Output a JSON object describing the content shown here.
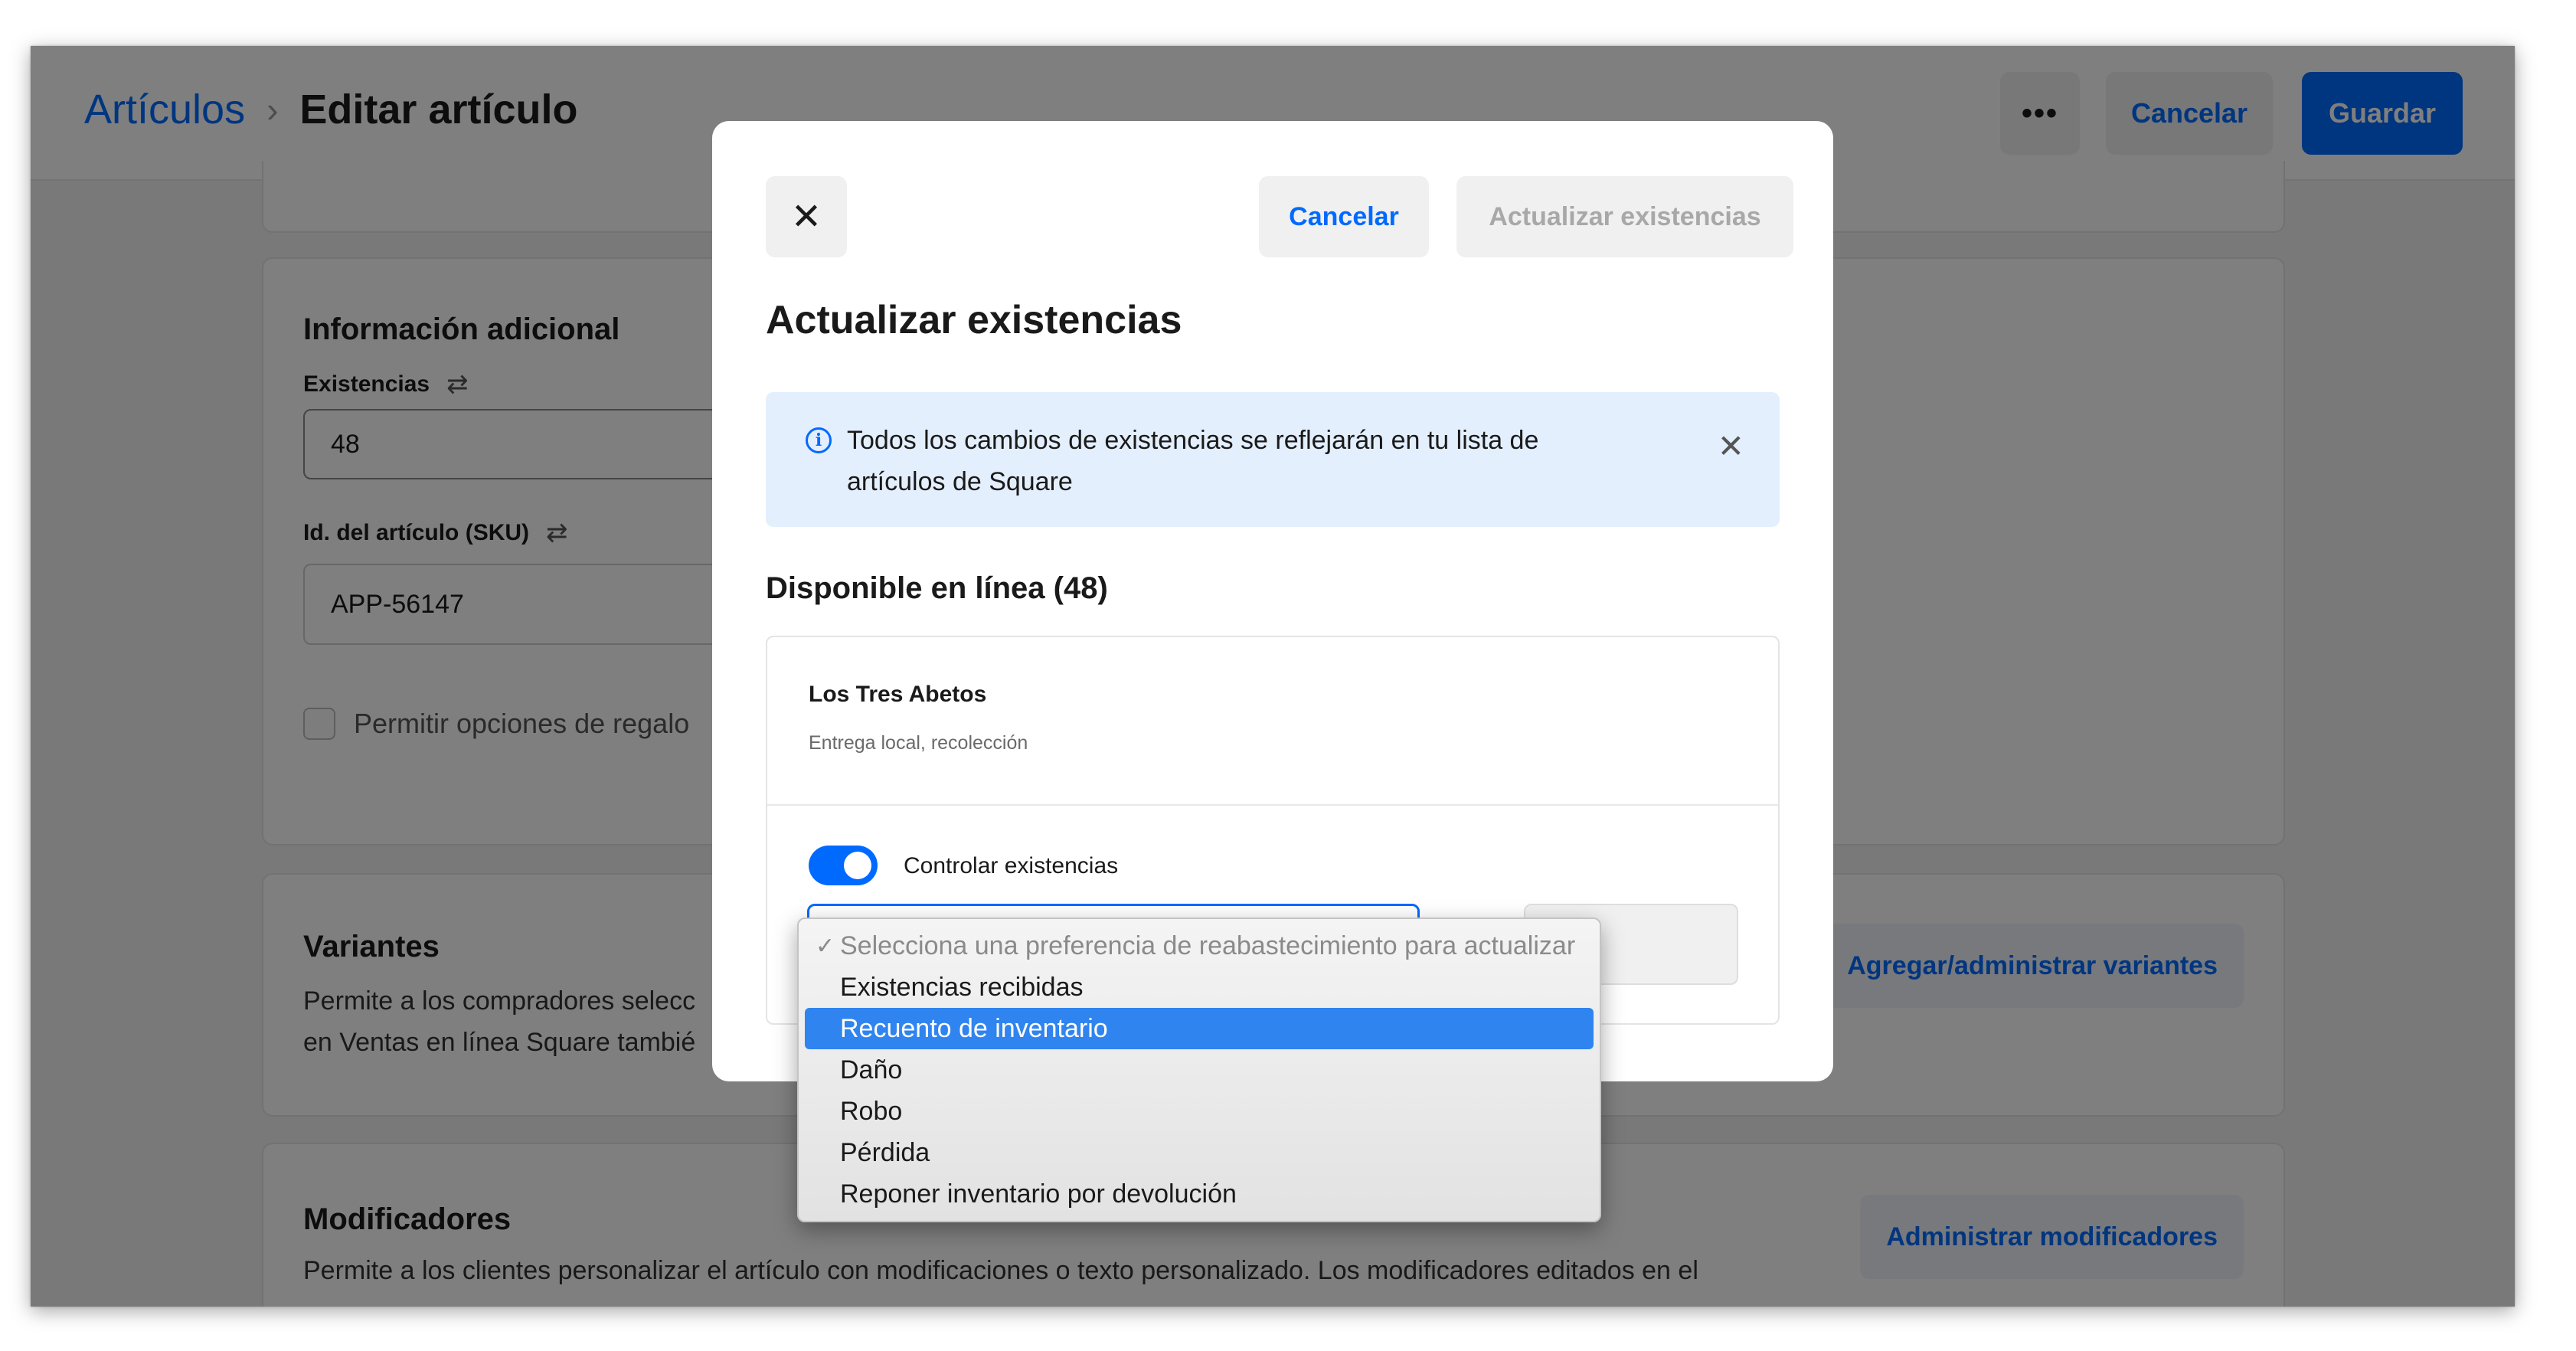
{
  "header": {
    "breadcrumb_parent": "Artículos",
    "breadcrumb_separator": "›",
    "breadcrumb_current": "Editar artículo",
    "more_label": "•••",
    "cancel_label": "Cancelar",
    "save_label": "Guardar"
  },
  "info_card": {
    "title": "Información adicional",
    "stock_label": "Existencias",
    "stock_value": "48",
    "sku_label": "Id. del artículo (SKU)",
    "sku_value": "APP-56147",
    "gift_label": "Permitir opciones de regalo",
    "sync_icon": "⇄"
  },
  "variants_card": {
    "title": "Variantes",
    "desc_line1": "Permite a los compradores selecc",
    "desc_line2": "en Ventas en línea Square tambié",
    "button": "Agregar/administrar variantes"
  },
  "modifiers_card": {
    "title": "Modificadores",
    "desc": "Permite a los clientes personalizar el artículo con modificaciones o texto personalizado. Los modificadores editados en el",
    "button": "Administrar modificadores"
  },
  "modal": {
    "close_icon": "✕",
    "cancel_label": "Cancelar",
    "update_label": "Actualizar existencias",
    "title": "Actualizar existencias",
    "banner_icon": "i",
    "banner_text": "Todos los cambios de existencias se reflejarán en tu lista de artículos de Square",
    "banner_close": "✕",
    "section_title": "Disponible en línea (48)",
    "location_name": "Los Tres Abetos",
    "location_sub": "Entrega local, recolección",
    "toggle_label": "Controlar existencias",
    "toggle_on": true
  },
  "dropdown": {
    "check_mark": "✓",
    "options": [
      {
        "label": "Selecciona una preferencia de reabastecimiento para actualizar",
        "state": "disabled"
      },
      {
        "label": "Existencias recibidas",
        "state": "normal"
      },
      {
        "label": "Recuento de inventario",
        "state": "selected"
      },
      {
        "label": "Daño",
        "state": "normal"
      },
      {
        "label": "Robo",
        "state": "normal"
      },
      {
        "label": "Pérdida",
        "state": "normal"
      },
      {
        "label": "Reponer inventario por devolución",
        "state": "normal"
      }
    ]
  },
  "colors": {
    "accent": "#006aff",
    "highlight": "#2f84f0",
    "banner_bg": "#e4effd"
  }
}
